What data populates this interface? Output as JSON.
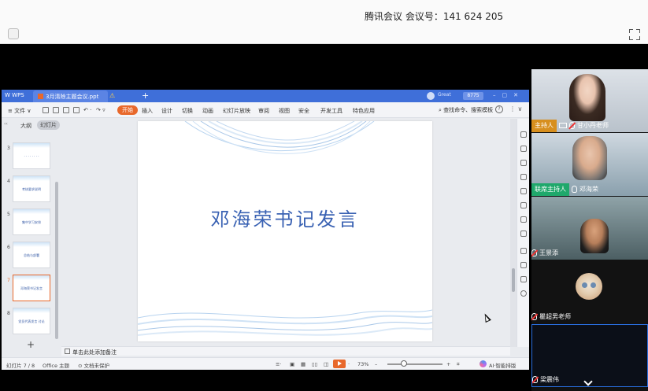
{
  "meeting": {
    "title": "腾讯会议 会议号：141 624 205"
  },
  "wps": {
    "app_name": "W WPS",
    "doc_tab": "3月清除主题会议.ppt",
    "user_name": "Great",
    "user_tag": "8775",
    "toolbar": {
      "file": "≡ 文件 ∨",
      "start": "开始",
      "tabs": [
        "插入",
        "设计",
        "切换",
        "动画",
        "幻灯片放映",
        "审阅",
        "视图",
        "安全",
        "开发工具",
        "特色应用"
      ],
      "search": "查找命令、搜索模板",
      "help": "?",
      "more": "⋮ ∨"
    },
    "left_pane": {
      "tab_outline": "大纲",
      "tab_slides": "幻灯片",
      "thumbnails": [
        {
          "num": "3",
          "text": "· · · · · · · ·"
        },
        {
          "num": "4",
          "text": "考核要求说明"
        },
        {
          "num": "5",
          "text": "集中学习安排"
        },
        {
          "num": "6",
          "text": "总结与部署"
        },
        {
          "num": "7",
          "text": "邓海荣书记发言"
        },
        {
          "num": "8",
          "text": "党员代表发言 讨论"
        }
      ],
      "add": "+"
    },
    "slide": {
      "title": "邓海荣书记发言"
    },
    "notes": "单击此处添加备注",
    "status": {
      "slide_count": "幻灯片 7 / 8",
      "theme": "Office 主题",
      "protect": "文档未保护",
      "zoom": "73%",
      "ai": "AI·智能排版"
    }
  },
  "participants": [
    {
      "role": "主持人",
      "name": "甘小丹老师"
    },
    {
      "role": "联席主持人",
      "name": "邓海荣"
    },
    {
      "role": "",
      "name": "王景添"
    },
    {
      "role": "",
      "name": "瞿超男老师"
    },
    {
      "role": "",
      "name": "梁震伟"
    }
  ]
}
